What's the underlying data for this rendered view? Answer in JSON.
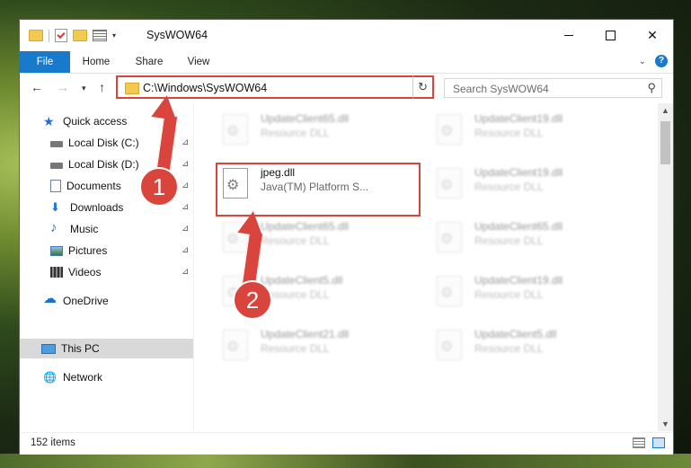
{
  "window": {
    "title": "SysWOW64"
  },
  "window_controls": {
    "close_label": "✕"
  },
  "ribbon": {
    "tabs": [
      "File",
      "Home",
      "Share",
      "View"
    ]
  },
  "navbar": {
    "back": "←",
    "forward": "→",
    "history": "▾",
    "up": "↑",
    "address": "C:\\Windows\\SysWOW64",
    "refresh": "↻",
    "search_placeholder": "Search SysWOW64",
    "search_icon": "⚲"
  },
  "navpane": {
    "items": [
      {
        "label": "Quick access",
        "icon": "star-icon"
      },
      {
        "label": "Local Disk (C:)",
        "icon": "disk-icon",
        "pinned": true
      },
      {
        "label": "Local Disk (D:)",
        "icon": "disk-icon",
        "pinned": true
      },
      {
        "label": "Documents",
        "icon": "documents-icon",
        "pinned": true
      },
      {
        "label": "Downloads",
        "icon": "download-icon",
        "pinned": true
      },
      {
        "label": "Music",
        "icon": "music-icon",
        "pinned": true
      },
      {
        "label": "Pictures",
        "icon": "pictures-icon",
        "pinned": true
      },
      {
        "label": "Videos",
        "icon": "videos-icon",
        "pinned": true
      },
      {
        "label": "OneDrive",
        "icon": "cloud-icon"
      },
      {
        "label": "This PC",
        "icon": "computer-icon",
        "selected": true
      },
      {
        "label": "Network",
        "icon": "network-icon"
      }
    ],
    "pin_glyph": "📌"
  },
  "files": [
    {
      "name": "UpdateClient65.dll",
      "type": "Resource DLL"
    },
    {
      "name": "UpdateClient19.dll",
      "type": "Resource DLL"
    },
    {
      "name": "jpeg.dll",
      "type": "Java(TM) Platform S..."
    },
    {
      "name": "UpdateClient19.dll",
      "type": "Resource DLL"
    },
    {
      "name": "UpdateClient65.dll",
      "type": "Resource DLL"
    },
    {
      "name": "UpdateClient65.dll",
      "type": "Resource DLL"
    },
    {
      "name": "UpdateClient5.dll",
      "type": "Resource DLL"
    },
    {
      "name": "UpdateClient19.dll",
      "type": "Resource DLL"
    },
    {
      "name": "UpdateClient21.dll",
      "type": "Resource DLL"
    },
    {
      "name": "UpdateClient5.dll",
      "type": "Resource DLL"
    }
  ],
  "status": {
    "item_count": "152 items"
  },
  "annotations": {
    "step1": "1",
    "step2": "2",
    "color": "#d9453c"
  }
}
